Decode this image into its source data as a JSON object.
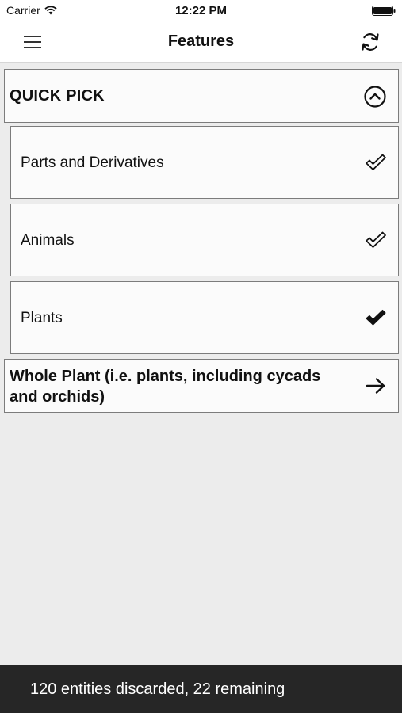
{
  "status_bar": {
    "carrier": "Carrier",
    "time": "12:22 PM",
    "icons": [
      "wifi-icon",
      "battery-icon"
    ]
  },
  "nav": {
    "title": "Features",
    "left_icon": "hamburger-menu-icon",
    "right_icon": "refresh-icon"
  },
  "quick_pick": {
    "label": "QUICK PICK",
    "icon": "chevron-up-circle-icon",
    "options": [
      {
        "label": "Parts and Derivatives",
        "state": "outline-check",
        "icon": "check-outline-icon"
      },
      {
        "label": "Animals",
        "state": "outline-check",
        "icon": "check-outline-icon"
      },
      {
        "label": "Plants",
        "state": "checked",
        "icon": "check-filled-icon"
      }
    ]
  },
  "whole_plant": {
    "label": "Whole Plant (i.e. plants, including cycads and orchids)",
    "icon": "arrow-right-icon"
  },
  "footer": {
    "text": "120 entities discarded, 22 remaining"
  },
  "colors": {
    "background": "#ececec",
    "card": "#fbfbfb",
    "border": "#7c7c7c",
    "footer": "#262626"
  }
}
